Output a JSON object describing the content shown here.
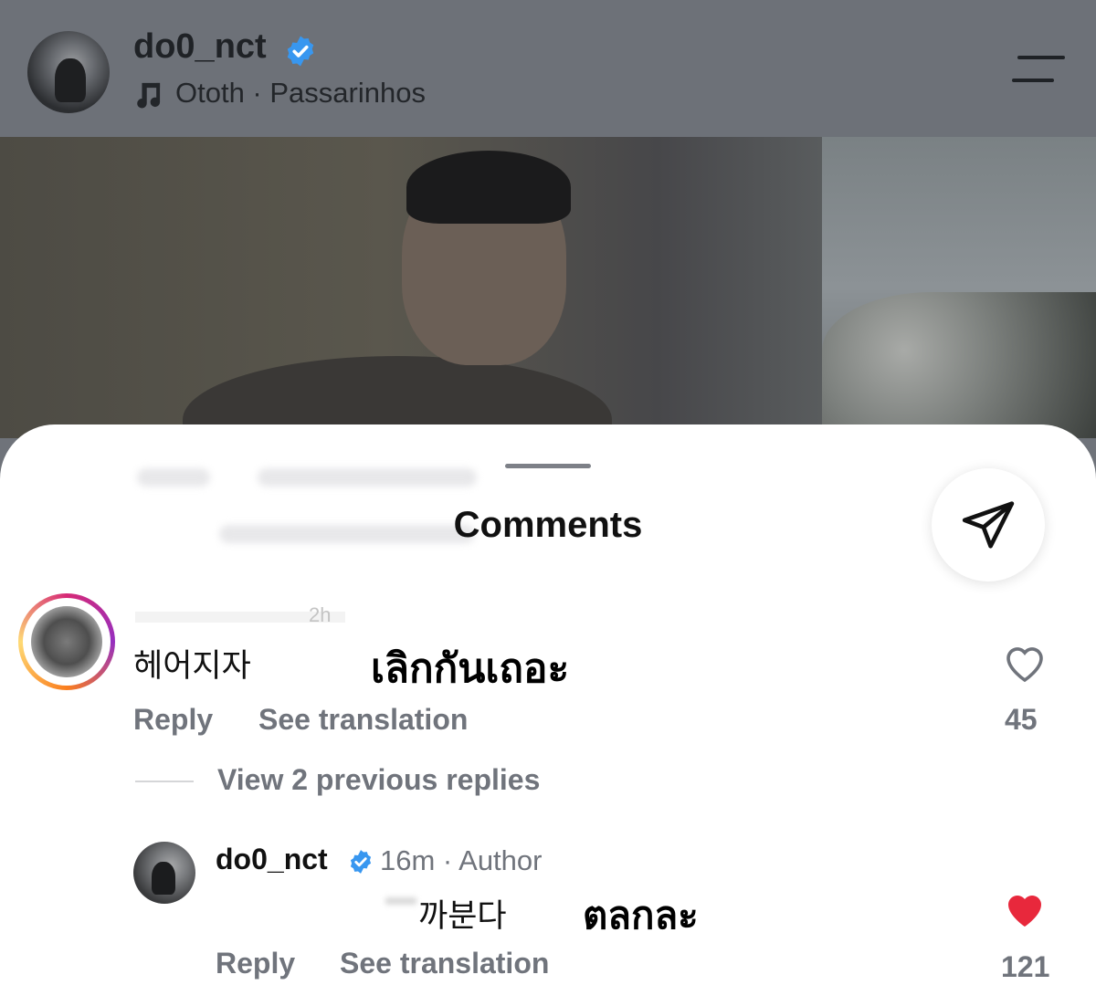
{
  "header": {
    "username": "do0_nct",
    "audio": "Ototh · Passarinhos"
  },
  "sheet": {
    "title": "Comments"
  },
  "comments": [
    {
      "time": "2h",
      "text": "헤어지자",
      "overlay_translation": "เลิกกันเถอะ",
      "reply_label": "Reply",
      "translate_label": "See translation",
      "likes": "45",
      "liked": false
    }
  ],
  "view_replies": "View 2 previous replies",
  "reply": {
    "username": "do0_nct",
    "time_author": "16m · Author",
    "text": "까분다",
    "overlay_translation": "ตลกละ",
    "reply_label": "Reply",
    "translate_label": "See translation",
    "likes": "121",
    "liked": true
  },
  "colors": {
    "like_red": "#e8283c",
    "verified_blue": "#3897f0",
    "secondary_text": "#70747c"
  },
  "icons": [
    "verified-badge-icon",
    "music-note-icon",
    "menu-icon",
    "share-send-icon",
    "heart-outline-icon",
    "heart-filled-icon"
  ]
}
